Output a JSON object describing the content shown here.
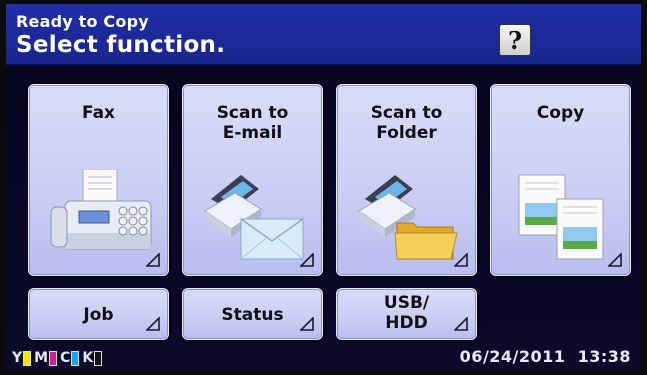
{
  "header": {
    "status": "Ready to Copy",
    "prompt": "Select function.",
    "help_label": "?"
  },
  "functions": [
    {
      "label_lines": [
        "Fax"
      ]
    },
    {
      "label_lines": [
        "Scan to",
        "E-mail"
      ]
    },
    {
      "label_lines": [
        "Scan to",
        "Folder"
      ]
    },
    {
      "label_lines": [
        "Copy"
      ]
    }
  ],
  "secondary": [
    {
      "label_lines": [
        "Job"
      ]
    },
    {
      "label_lines": [
        "Status"
      ]
    },
    {
      "label_lines": [
        "USB/",
        "HDD"
      ]
    }
  ],
  "toner": [
    {
      "letter": "Y",
      "color": "#f2e600"
    },
    {
      "letter": "M",
      "color": "#e0169b"
    },
    {
      "letter": "C",
      "color": "#19a6e6"
    },
    {
      "letter": "K",
      "color": "#111111"
    }
  ],
  "footer": {
    "date": "06/24/2011",
    "time": "13:38"
  },
  "colors": {
    "header_bg": "#1f2fa7",
    "tile_bg": "#d0d3f6",
    "screen_bg": "#05051e"
  }
}
